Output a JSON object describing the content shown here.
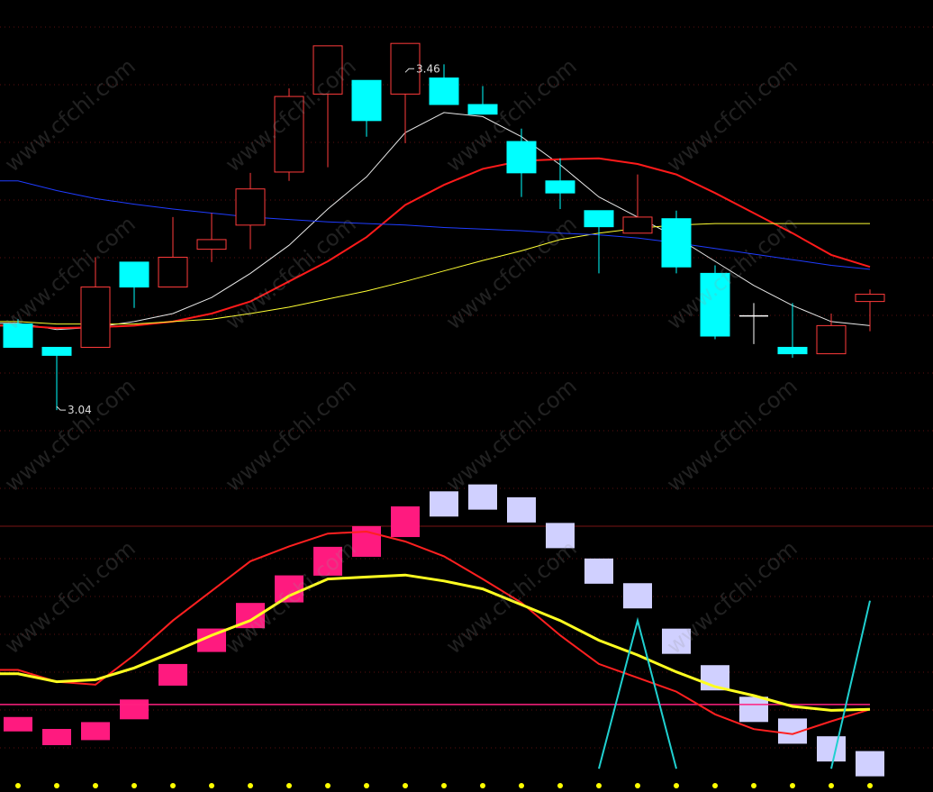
{
  "watermark": "www.cfchi.com",
  "colors": {
    "up": "#ff3b3b",
    "down": "#00ffff",
    "doji": "#ffffff",
    "ma5": "#e8e8e8",
    "ma10": "#ff1a1a",
    "ma20": "#ffff33",
    "ma60": "#1f3cff",
    "k_line": "#ff2020",
    "d_line": "#ffff20",
    "osc_pos": "#ff1a7f",
    "osc_neg": "#d0d0ff",
    "signal_line": "#20d0d0",
    "zero_line": "#ff2080",
    "grid": "#5a0f0f",
    "divider": "#7a1515",
    "dot": "#ffff00",
    "label": "#dddddd"
  },
  "chart_data": [
    {
      "type": "candlestick",
      "title": "",
      "ylim": [
        2.9,
        3.55
      ],
      "annotations": [
        {
          "text": "3.46",
          "candle_index": 10,
          "at": "high"
        },
        {
          "text": "3.04",
          "candle_index": 1,
          "at": "low"
        }
      ],
      "candles": [
        {
          "o": 3.147,
          "h": 3.153,
          "l": 3.118,
          "c": 3.118
        },
        {
          "o": 3.118,
          "h": 3.118,
          "l": 3.04,
          "c": 3.108
        },
        {
          "o": 3.118,
          "h": 3.23,
          "l": 3.118,
          "c": 3.193
        },
        {
          "o": 3.224,
          "h": 3.224,
          "l": 3.167,
          "c": 3.193
        },
        {
          "o": 3.193,
          "h": 3.28,
          "l": 3.193,
          "c": 3.23
        },
        {
          "o": 3.24,
          "h": 3.285,
          "l": 3.224,
          "c": 3.252
        },
        {
          "o": 3.27,
          "h": 3.335,
          "l": 3.24,
          "c": 3.315
        },
        {
          "o": 3.336,
          "h": 3.44,
          "l": 3.325,
          "c": 3.43
        },
        {
          "o": 3.433,
          "h": 3.46,
          "l": 3.342,
          "c": 3.493
        },
        {
          "o": 3.45,
          "h": 3.45,
          "l": 3.38,
          "c": 3.4
        },
        {
          "o": 3.433,
          "h": 3.46,
          "l": 3.372,
          "c": 3.496
        },
        {
          "o": 3.453,
          "h": 3.47,
          "l": 3.42,
          "c": 3.42
        },
        {
          "o": 3.42,
          "h": 3.443,
          "l": 3.408,
          "c": 3.408
        },
        {
          "o": 3.374,
          "h": 3.39,
          "l": 3.305,
          "c": 3.335
        },
        {
          "o": 3.325,
          "h": 3.353,
          "l": 3.29,
          "c": 3.31
        },
        {
          "o": 3.288,
          "h": 3.288,
          "l": 3.21,
          "c": 3.268
        },
        {
          "o": 3.26,
          "h": 3.333,
          "l": 3.278,
          "c": 3.28
        },
        {
          "o": 3.278,
          "h": 3.288,
          "l": 3.21,
          "c": 3.218
        },
        {
          "o": 3.21,
          "h": 3.22,
          "l": 3.128,
          "c": 3.132
        },
        {
          "o": 3.157,
          "h": 3.173,
          "l": 3.122,
          "c": 3.157
        },
        {
          "o": 3.118,
          "h": 3.173,
          "l": 3.105,
          "c": 3.11
        },
        {
          "o": 3.11,
          "h": 3.16,
          "l": 3.11,
          "c": 3.145
        },
        {
          "o": 3.175,
          "h": 3.19,
          "l": 3.138,
          "c": 3.184
        }
      ],
      "ma_lines": [
        {
          "key": "ma5",
          "values": [
            3.148,
            3.14,
            3.143,
            3.15,
            3.16,
            3.18,
            3.21,
            3.245,
            3.29,
            3.33,
            3.385,
            3.41,
            3.405,
            3.38,
            3.345,
            3.305,
            3.28,
            3.255,
            3.225,
            3.195,
            3.17,
            3.15,
            3.145
          ]
        },
        {
          "key": "ma10",
          "values": [
            3.145,
            3.142,
            3.143,
            3.145,
            3.15,
            3.16,
            3.175,
            3.2,
            3.225,
            3.255,
            3.295,
            3.32,
            3.34,
            3.35,
            3.352,
            3.353,
            3.346,
            3.333,
            3.31,
            3.285,
            3.26,
            3.233,
            3.218
          ]
        },
        {
          "key": "ma20",
          "values": [
            3.15,
            3.147,
            3.147,
            3.147,
            3.15,
            3.153,
            3.16,
            3.168,
            3.178,
            3.188,
            3.2,
            3.213,
            3.226,
            3.238,
            3.252,
            3.26,
            3.266,
            3.27,
            3.272,
            3.272,
            3.272,
            3.272,
            3.272
          ]
        },
        {
          "key": "ma60",
          "values": [
            3.325,
            3.313,
            3.303,
            3.296,
            3.29,
            3.285,
            3.28,
            3.277,
            3.274,
            3.272,
            3.27,
            3.267,
            3.265,
            3.263,
            3.26,
            3.258,
            3.254,
            3.248,
            3.241,
            3.234,
            3.227,
            3.22,
            3.215
          ]
        }
      ]
    },
    {
      "type": "bar",
      "title": "",
      "ylim": [
        -40,
        220
      ],
      "osc_values": [
        25,
        12,
        18,
        40,
        75,
        110,
        135,
        162,
        190,
        210,
        230,
        248,
        255,
        242,
        216,
        180,
        155,
        109,
        72,
        40,
        18,
        0,
        -15
      ],
      "k_values": [
        80,
        68,
        65,
        95,
        130,
        160,
        190,
        205,
        218,
        220,
        210,
        195,
        172,
        148,
        115,
        86,
        72,
        58,
        35,
        20,
        15,
        28,
        40
      ],
      "d_values": [
        76,
        68,
        70,
        82,
        98,
        115,
        130,
        155,
        172,
        174,
        176,
        170,
        162,
        146,
        130,
        110,
        95,
        78,
        63,
        54,
        43,
        39,
        40
      ],
      "signal_values": [
        null,
        null,
        null,
        null,
        null,
        null,
        null,
        null,
        null,
        null,
        null,
        null,
        null,
        null,
        null,
        -20,
        130,
        -20,
        null,
        null,
        null,
        -20,
        150
      ],
      "zero_line": 45
    }
  ]
}
